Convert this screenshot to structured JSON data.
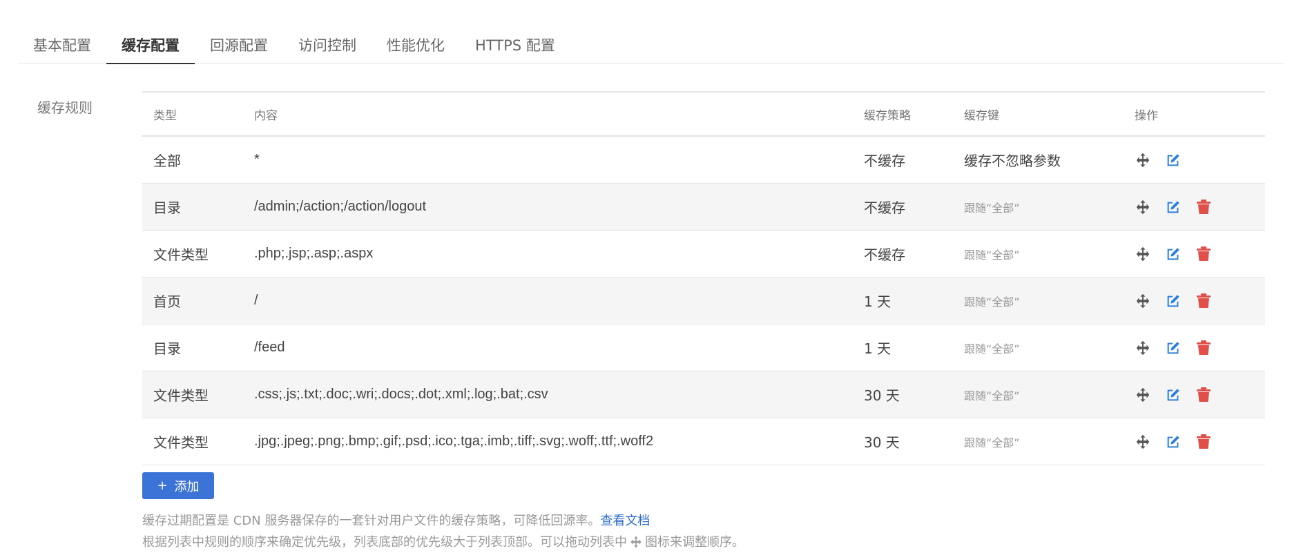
{
  "tabs": [
    {
      "label": "基本配置",
      "active": false
    },
    {
      "label": "缓存配置",
      "active": true
    },
    {
      "label": "回源配置",
      "active": false
    },
    {
      "label": "访问控制",
      "active": false
    },
    {
      "label": "性能优化",
      "active": false
    },
    {
      "label": "HTTPS 配置",
      "active": false
    }
  ],
  "section_label": "缓存规则",
  "table": {
    "headers": {
      "type": "类型",
      "content": "内容",
      "policy": "缓存策略",
      "key": "缓存键",
      "ops": "操作"
    },
    "rows": [
      {
        "type": "全部",
        "content": "*",
        "policy": "不缓存",
        "key": "缓存不忽略参数",
        "deletable": false
      },
      {
        "type": "目录",
        "content": "/admin;/action;/action/logout",
        "policy": "不缓存",
        "key": "跟随“全部”",
        "deletable": true
      },
      {
        "type": "文件类型",
        "content": ".php;.jsp;.asp;.aspx",
        "policy": "不缓存",
        "key": "跟随“全部”",
        "deletable": true
      },
      {
        "type": "首页",
        "content": "/",
        "policy": "1 天",
        "key": "跟随“全部”",
        "deletable": true
      },
      {
        "type": "目录",
        "content": "/feed",
        "policy": "1 天",
        "key": "跟随“全部”",
        "deletable": true
      },
      {
        "type": "文件类型",
        "content": ".css;.js;.txt;.doc;.wri;.docs;.dot;.xml;.log;.bat;.csv",
        "policy": "30 天",
        "key": "跟随“全部”",
        "deletable": true
      },
      {
        "type": "文件类型",
        "content": ".jpg;.jpeg;.png;.bmp;.gif;.psd;.ico;.tga;.imb;.tiff;.svg;.woff;.ttf;.woff2",
        "policy": "30 天",
        "key": "跟随“全部”",
        "deletable": true
      }
    ]
  },
  "add_button": {
    "icon": "+",
    "label": "添加"
  },
  "notes": {
    "line1": "缓存过期配置是 CDN 服务器保存的一套针对用户文件的缓存策略，可降低回源率。",
    "line1_link": "查看文档",
    "line2_before": "根据列表中规则的顺序来确定优先级，列表底部的优先级大于列表顶部。可以拖动列表中",
    "line2_after": "图标来调整顺序。"
  },
  "icons": {
    "move": "move-icon",
    "edit": "edit-icon",
    "delete": "trash-icon"
  },
  "colors": {
    "primary": "#3b73d6",
    "edit": "#2f7fd8",
    "delete": "#e0504a",
    "link": "#2f6fcf"
  }
}
